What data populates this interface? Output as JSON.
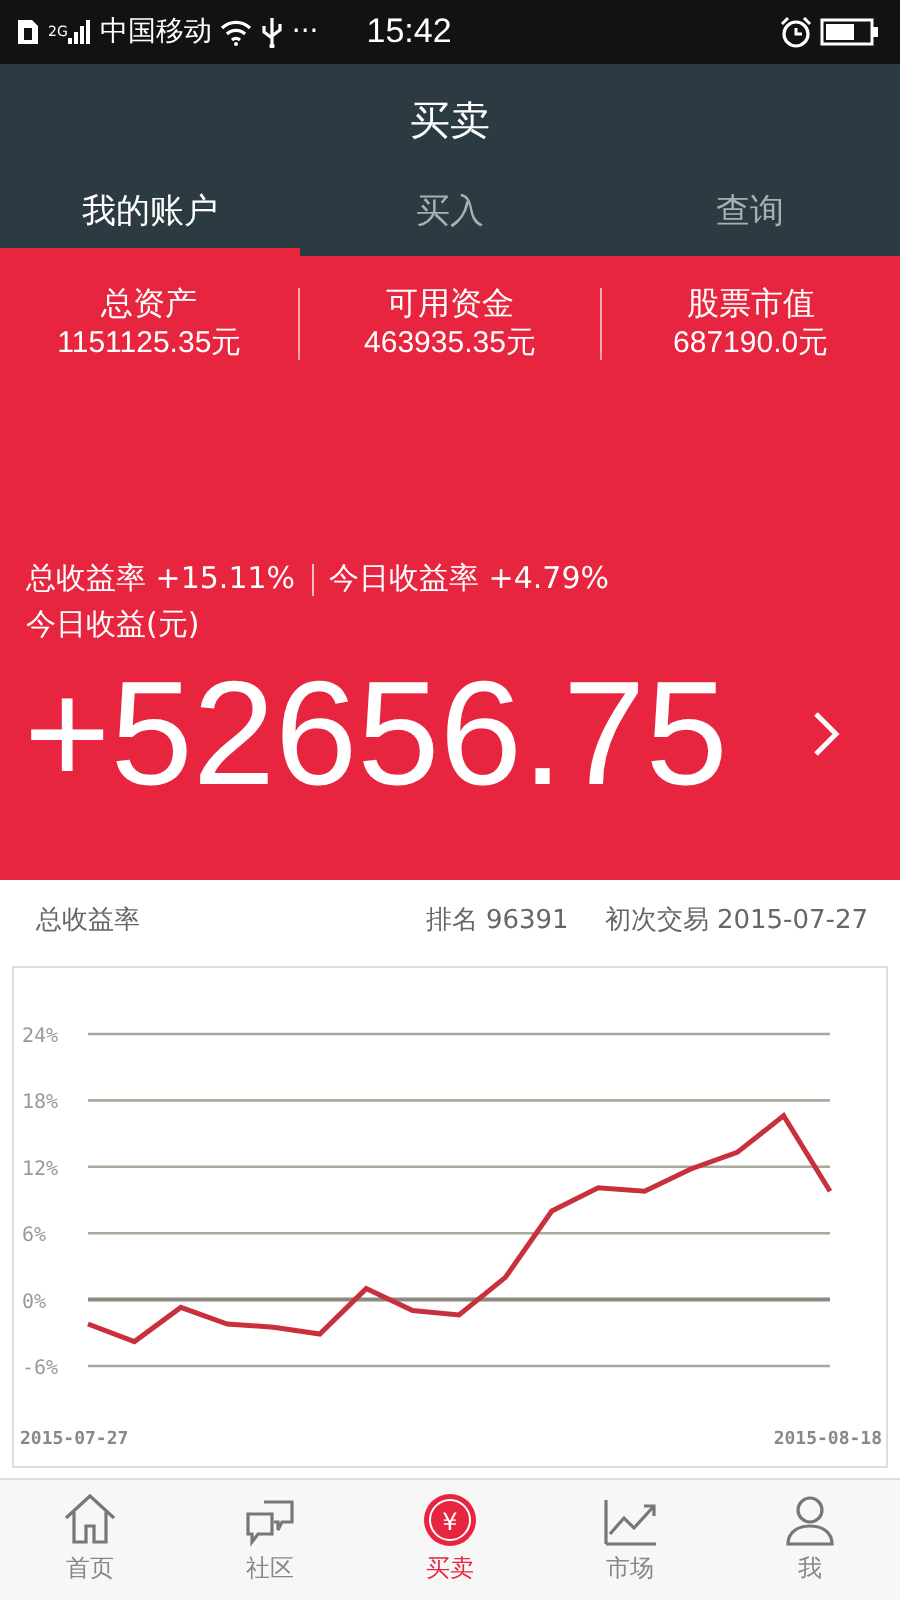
{
  "status_bar": {
    "network": "2G",
    "carrier": "中国移动",
    "more": "···",
    "time": "15:42"
  },
  "header": {
    "title": "买卖"
  },
  "tabs": [
    {
      "label": "我的账户",
      "selected": true
    },
    {
      "label": "买入",
      "selected": false
    },
    {
      "label": "查询",
      "selected": false
    }
  ],
  "summary": [
    {
      "label": "总资产",
      "value": "1151125.35元"
    },
    {
      "label": "可用资金",
      "value": "463935.35元"
    },
    {
      "label": "股票市值",
      "value": "687190.0元"
    }
  ],
  "rates": [
    {
      "label": "总收益率",
      "value": "+15.11%"
    },
    {
      "label": "今日收益率",
      "value": "+4.79%"
    }
  ],
  "today_label": "今日收益(元)",
  "today_value": "+52656.75",
  "info_row": {
    "title": "总收益率",
    "rank": "排名 96391",
    "first_trade": "初次交易 2015-07-27"
  },
  "chart": {
    "chart_data": {
      "type": "line",
      "categories": [
        "2015-07-27",
        null,
        null,
        null,
        null,
        null,
        null,
        null,
        null,
        null,
        null,
        null,
        null,
        null,
        null,
        null,
        "2015-08-18"
      ],
      "series": [
        {
          "color": "#c8303c",
          "values": [
            -2.2,
            -3.8,
            -0.7,
            -2.2,
            -2.5,
            -3.1,
            1.0,
            -1.0,
            -1.4,
            2.0,
            8.0,
            10.1,
            9.8,
            11.8,
            13.3,
            16.6,
            9.8
          ]
        }
      ],
      "ylim": [
        -6,
        24
      ],
      "grid": true,
      "yticks": [
        {
          "value": 24,
          "label": "24%"
        },
        {
          "value": 18,
          "label": "18%"
        },
        {
          "value": 12,
          "label": "12%"
        },
        {
          "value": 6,
          "label": "6%"
        },
        {
          "value": 0,
          "label": "0%"
        },
        {
          "value": -6,
          "label": "-6%"
        }
      ]
    }
  },
  "nav": [
    {
      "kind": "home",
      "label": "首页",
      "selected": false
    },
    {
      "kind": "community",
      "label": "社区",
      "selected": false
    },
    {
      "kind": "trade",
      "label": "买卖",
      "selected": true,
      "icon_text": "¥"
    },
    {
      "kind": "market",
      "label": "市场",
      "selected": false
    },
    {
      "kind": "me",
      "label": "我",
      "selected": false
    }
  ]
}
